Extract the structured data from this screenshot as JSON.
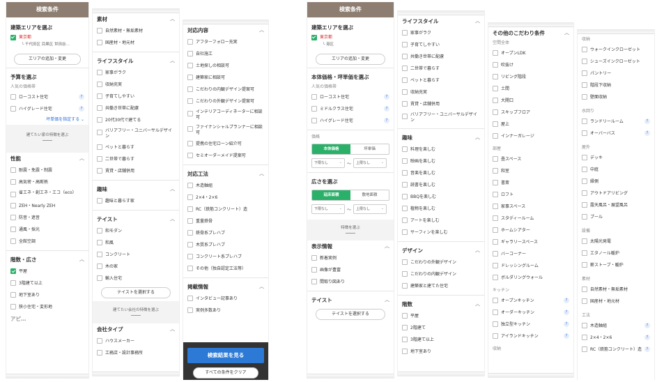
{
  "c1": {
    "header": "検索条件",
    "area_title": "建築エリアを選ぶ",
    "area_pref": "東京都",
    "area_cities": "└ 千代田区 目黒区 世田谷…",
    "area_btn": "エリアの追加・変更",
    "budget_title": "予算を選ぶ",
    "budget_sub": "人気の価格帯",
    "budget_items": [
      "ローコスト住宅",
      "ハイグレード住宅"
    ],
    "budget_link": "坪単価を指定する ⌄",
    "note": "建てたい家の特徴を選ぶ",
    "perf_title": "性能",
    "perf_items": [
      "耐震・免震・制震",
      "高気密・高断熱",
      "省エネ・創エネ・エコ（eco）",
      "ZEH・Nearly ZEH",
      "防音・遮音",
      "通風・採光",
      "全館空調"
    ],
    "floor_title": "階数・広さ",
    "floor_items": [
      "平屋",
      "3階建て以上",
      "地下室あり",
      "狭小住宅・変形地"
    ],
    "cut": "アピ…"
  },
  "c2": {
    "s1_title": "素材",
    "s1_items": [
      "自然素材・無垢素材",
      "国産材・地元材"
    ],
    "s2_title": "ライフスタイル",
    "s2_items": [
      "家事がラク",
      "収納充実",
      "子育てしやすい",
      "共働き世帯に配慮",
      "20代30代で建てる",
      "バリアフリー・ユニバーサルデザイン",
      "ペットと暮らす",
      "二世帯で暮らす",
      "賃貸・店舗併用"
    ],
    "s3_title": "趣味",
    "s3_items": [
      "趣味と暮らす家"
    ],
    "s4_title": "テイスト",
    "s4_items": [
      "和モダン",
      "和風",
      "コンクリート",
      "木の家",
      "輸入住宅"
    ],
    "s4_btn": "テイストを選択する",
    "note": "建てたい会社の特徴を選ぶ",
    "s5_title": "会社タイプ",
    "s5_items": [
      "ハウスメーカー",
      "工務店・設計事務所"
    ]
  },
  "c3": {
    "s1_title": "対応内容",
    "s1_items": [
      "アフターフォロー充実",
      "自社施工",
      "土地探しの相談可",
      "建築家に相談可",
      "こだわりの内観デザイン提案可",
      "こだわりの外観デザイン提案可",
      "インテリアコーディネーターに相談可",
      "ファイナンシャルプランナーに相談可",
      "提携の住宅ローン紹介可",
      "セミオーダーメイド提案可"
    ],
    "s2_title": "対応工法",
    "s2_items": [
      "木造軸組",
      "2×4・2×6",
      "RC（鉄筋コンクリート）造",
      "重量鉄骨",
      "鉄骨系プレハブ",
      "木質系プレハブ",
      "コンクリート系プレハブ",
      "その他（独自認定工法等）"
    ],
    "s3_title": "掲載情報",
    "s3_items": [
      "インタビュー記事あり",
      "実例多数あり"
    ],
    "search_btn": "検索結果を見る",
    "clear_btn": "すべての条件をクリア"
  },
  "c4": {
    "header": "検索条件",
    "area_title": "建築エリアを選ぶ",
    "area_pref": "東京都",
    "area_cities": "└ 港区",
    "area_btn": "エリアの追加・変更",
    "body_title": "本体価格・坪単価を選ぶ",
    "body_sub": "人気の価格帯",
    "body_items": [
      "ローコスト住宅",
      "ミドルクラス住宅",
      "ハイグレード住宅"
    ],
    "price_label": "価格",
    "price_tabs": [
      "本体価格",
      "坪単価"
    ],
    "price_min": "下限なし",
    "price_max": "上限なし",
    "tilde": "〜",
    "size_title": "広さを選ぶ",
    "size_tabs": [
      "延床面積",
      "敷地面積"
    ],
    "size_min": "下限なし",
    "size_max": "上限なし",
    "note": "特徴を選ぶ",
    "disp_title": "表示情報",
    "disp_items": [
      "新着実例",
      "画像が豊富",
      "間取り図あり"
    ],
    "taste_title": "テイスト",
    "taste_btn": "テイストを選択する"
  },
  "c5": {
    "s1_title": "ライフスタイル",
    "s1_items": [
      "家事がラク",
      "子育てしやすい",
      "共働き世帯に配慮",
      "二世帯で暮らす",
      "ペットと暮らす",
      "収納充実",
      "賃貸・店舗併用",
      "バリアフリー・ユニバーサルデザイン"
    ],
    "s2_title": "趣味",
    "s2_items": [
      "料理を楽しむ",
      "映画を楽しむ",
      "音楽を楽しむ",
      "読書を楽しむ",
      "BBQを楽しむ",
      "植物を楽しむ",
      "アートを楽しむ",
      "サーフィンを楽しむ"
    ],
    "s3_title": "デザイン",
    "s3_items": [
      "こだわりの外観デザイン",
      "こだわりの内観デザイン",
      "建築家と建てた住宅"
    ],
    "s4_title": "階数",
    "s4_items": [
      "平屋",
      "2階建て",
      "3階建て以上",
      "地下室あり"
    ]
  },
  "c6": {
    "title": "その他のこだわり条件",
    "g1": "空間全体",
    "g1_items": [
      "オープンLDK",
      "吹抜け",
      "リビング階段",
      "土間",
      "大開口",
      "スキップフロア",
      "屋上",
      "インナーガレージ"
    ],
    "g2": "部屋",
    "g2_items": [
      "畳スペース",
      "和室",
      "書斎",
      "ロフト",
      "家事スペース",
      "スタディールーム",
      "ホームシアター",
      "ギャラリースペース",
      "バーコーナー",
      "ドレッシングルーム",
      "ボルダリングウォール"
    ],
    "g3": "キッチン",
    "g3_items": [
      "オープンキッチン",
      "オーダーキッチン",
      "独立型キッチン",
      "アイランドキッチン"
    ],
    "g4": "収納"
  },
  "c7": {
    "g1": "収納",
    "g1_items": [
      "ウォークインクローゼット",
      "シューズインクローゼット",
      "パントリー",
      "階段下収納",
      "壁面収納"
    ],
    "g2": "水回り",
    "g2_items": [
      "ランドリールーム",
      "オーバーバス"
    ],
    "g3": "屋外",
    "g3_items": [
      "デッキ",
      "中庭",
      "縁側",
      "アウトドアリビング",
      "露天風呂・展望風呂",
      "プール"
    ],
    "g4": "設備",
    "g4_items": [
      "太陽光発電",
      "エタノール暖炉",
      "薪ストーブ・暖炉"
    ],
    "g5": "素材",
    "g5_items": [
      "自然素材・無垢素材",
      "国産材・地元材"
    ],
    "g6": "工法",
    "g6_items": [
      "木造軸組",
      "2×4・2×6",
      "RC（鉄筋コンクリート）造"
    ]
  },
  "colors": {
    "header_bg": "#8e7e72",
    "check_green": "#2bb06a",
    "blue": "#2c7ad6",
    "pref_red": "#d33"
  }
}
